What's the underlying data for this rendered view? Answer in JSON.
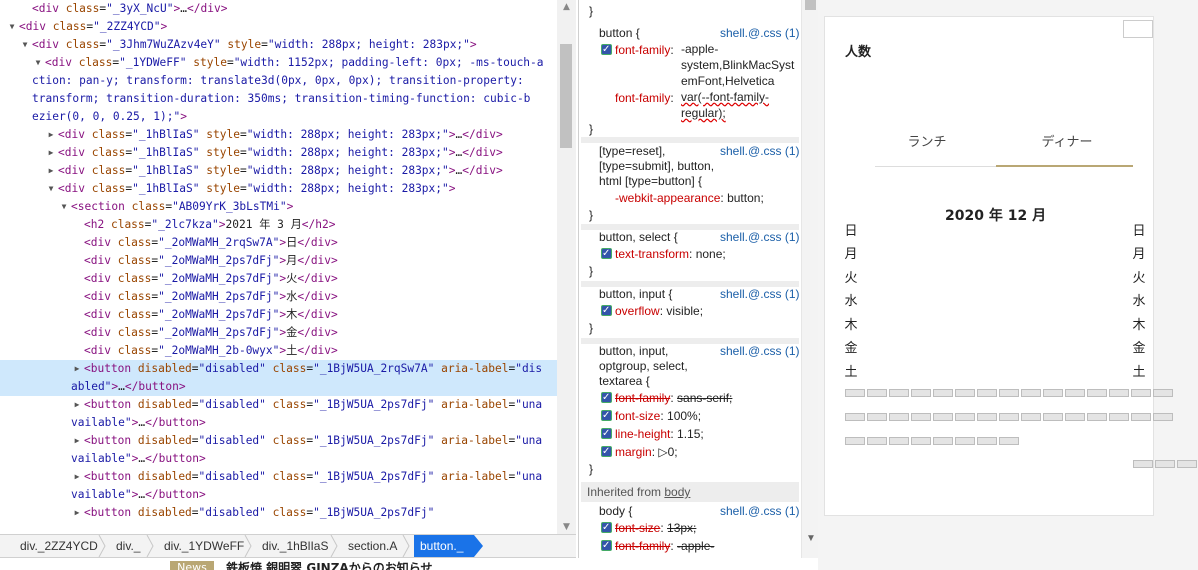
{
  "dom_tree": [
    {
      "depth": 2,
      "arrow": "",
      "text": "<div class=\"_3yX_NcU\">…</div>"
    },
    {
      "depth": 1,
      "arrow": "▼",
      "text": "<div class=\"_2ZZ4YCD\">"
    },
    {
      "depth": 2,
      "arrow": "▼",
      "text": "<div class=\"_3Jhm7WuZAzv4eY\" style=\"width: 288px; height: 283px;\">"
    },
    {
      "depth": 3,
      "arrow": "▼",
      "text": "<div class=\"_1YDWeFF\" style=\"width: 1152px; padding-left: 0px; -ms-touch-action: pan-y; transform: translate3d(0px, 0px, 0px); transition-property: transform; transition-duration: 350ms; transition-timing-function: cubic-bezier(0, 0, 0.25, 1);\">"
    },
    {
      "depth": 4,
      "arrow": "▶",
      "text": "<div class=\"_1hBlIaS\" style=\"width: 288px; height: 283px;\">…</div>"
    },
    {
      "depth": 4,
      "arrow": "▶",
      "text": "<div class=\"_1hBlIaS\" style=\"width: 288px; height: 283px;\">…</div>"
    },
    {
      "depth": 4,
      "arrow": "▶",
      "text": "<div class=\"_1hBlIaS\" style=\"width: 288px; height: 283px;\">…</div>"
    },
    {
      "depth": 4,
      "arrow": "▼",
      "text": "<div class=\"_1hBlIaS\" style=\"width: 288px; height: 283px;\">"
    },
    {
      "depth": 5,
      "arrow": "▼",
      "text": "<section class=\"AB09YrK_3bLsTMi\">"
    },
    {
      "depth": 6,
      "arrow": "",
      "text": "<h2 class=\"_2lc7kza\">2021 年 3 月</h2>"
    },
    {
      "depth": 6,
      "arrow": "",
      "text": "<div class=\"_2oMWaMH_2rqSw7A\">日</div>"
    },
    {
      "depth": 6,
      "arrow": "",
      "text": "<div class=\"_2oMWaMH_2ps7dFj\">月</div>"
    },
    {
      "depth": 6,
      "arrow": "",
      "text": "<div class=\"_2oMWaMH_2ps7dFj\">火</div>"
    },
    {
      "depth": 6,
      "arrow": "",
      "text": "<div class=\"_2oMWaMH_2ps7dFj\">水</div>"
    },
    {
      "depth": 6,
      "arrow": "",
      "text": "<div class=\"_2oMWaMH_2ps7dFj\">木</div>"
    },
    {
      "depth": 6,
      "arrow": "",
      "text": "<div class=\"_2oMWaMH_2ps7dFj\">金</div>"
    },
    {
      "depth": 6,
      "arrow": "",
      "text": "<div class=\"_2oMWaMH_2b-0wyx\">土</div>"
    },
    {
      "depth": 6,
      "arrow": "▶",
      "selected": true,
      "text": "<button disabled=\"disabled\" class=\"_1BjW5UA_2rqSw7A\" aria-label=\"disabled\">…</button>"
    },
    {
      "depth": 6,
      "arrow": "▶",
      "text": "<button disabled=\"disabled\" class=\"_1BjW5UA_2ps7dFj\" aria-label=\"unavailable\">…</button>"
    },
    {
      "depth": 6,
      "arrow": "▶",
      "text": "<button disabled=\"disabled\" class=\"_1BjW5UA_2ps7dFj\" aria-label=\"unavailable\">…</button>"
    },
    {
      "depth": 6,
      "arrow": "▶",
      "text": "<button disabled=\"disabled\" class=\"_1BjW5UA_2ps7dFj\" aria-label=\"unavailable\">…</button>"
    },
    {
      "depth": 6,
      "arrow": "▶",
      "text": "<button disabled=\"disabled\" class=\"_1BjW5UA_2ps7dFj\""
    }
  ],
  "breadcrumbs": [
    "div._2ZZ4YCD",
    "div._",
    "div._1YDWeFF",
    "div._1hBlIaS",
    "section.A",
    "button._"
  ],
  "styles": {
    "top_brace": "}",
    "rules": [
      {
        "selector": "button  {",
        "source": "shell.@.css (1)",
        "props": [
          {
            "name": "font-family",
            "value": "-apple-system,BlinkMacSystemFont,Helvetica",
            "checkbox": true
          },
          {
            "name": "font-family",
            "value": "var(--font-family-regular);",
            "checkbox": false,
            "wavy": true
          }
        ]
      },
      {
        "selector": "[type=reset], [type=submit], button, html [type=button]  {",
        "source": "shell.@.css (1)",
        "props": [
          {
            "name": "-webkit-appearance",
            "value": "button;",
            "checkbox": false
          }
        ]
      },
      {
        "selector": "button, select  {",
        "source": "shell.@.css (1)",
        "props": [
          {
            "name": "text-transform",
            "value": "none;",
            "checkbox": true
          }
        ]
      },
      {
        "selector": "button, input  {",
        "source": "shell.@.css (1)",
        "props": [
          {
            "name": "overflow",
            "value": "visible;",
            "checkbox": true
          }
        ]
      },
      {
        "selector": "button, input, optgroup, select, textarea  {",
        "source": "shell.@.css (1)",
        "props": [
          {
            "name": "font-family",
            "value": "sans-serif;",
            "checkbox": true,
            "strike": true
          },
          {
            "name": "font-size",
            "value": "100%;",
            "checkbox": true
          },
          {
            "name": "line-height",
            "value": "1.15;",
            "checkbox": true
          },
          {
            "name": "margin",
            "value": "▷0;",
            "checkbox": true
          }
        ]
      }
    ],
    "inherited_label": "Inherited from",
    "inherited_from": "body",
    "body_rule": {
      "selector": "body  {",
      "source": "shell.@.css (1)",
      "props": [
        {
          "name": "font-size",
          "value": "13px;",
          "checkbox": true,
          "strike": true
        },
        {
          "name": "font-family",
          "value": "-apple-",
          "checkbox": true,
          "strike": true
        }
      ]
    }
  },
  "preview": {
    "title": "人数",
    "tabs": [
      "ランチ",
      "ディナー"
    ],
    "active_tab": 1,
    "month": "2020 年 12 月",
    "weekdays": [
      "日",
      "月",
      "火",
      "水",
      "木",
      "金",
      "土"
    ],
    "news_badge": "News",
    "news_text": "鉄板焼 銀明翠 GINZAからのお知らせ"
  },
  "colors": {
    "selected_row": "#cfe8fc",
    "breadcrumb_active": "#1a73e8",
    "tab_accent": "#b9a774"
  }
}
